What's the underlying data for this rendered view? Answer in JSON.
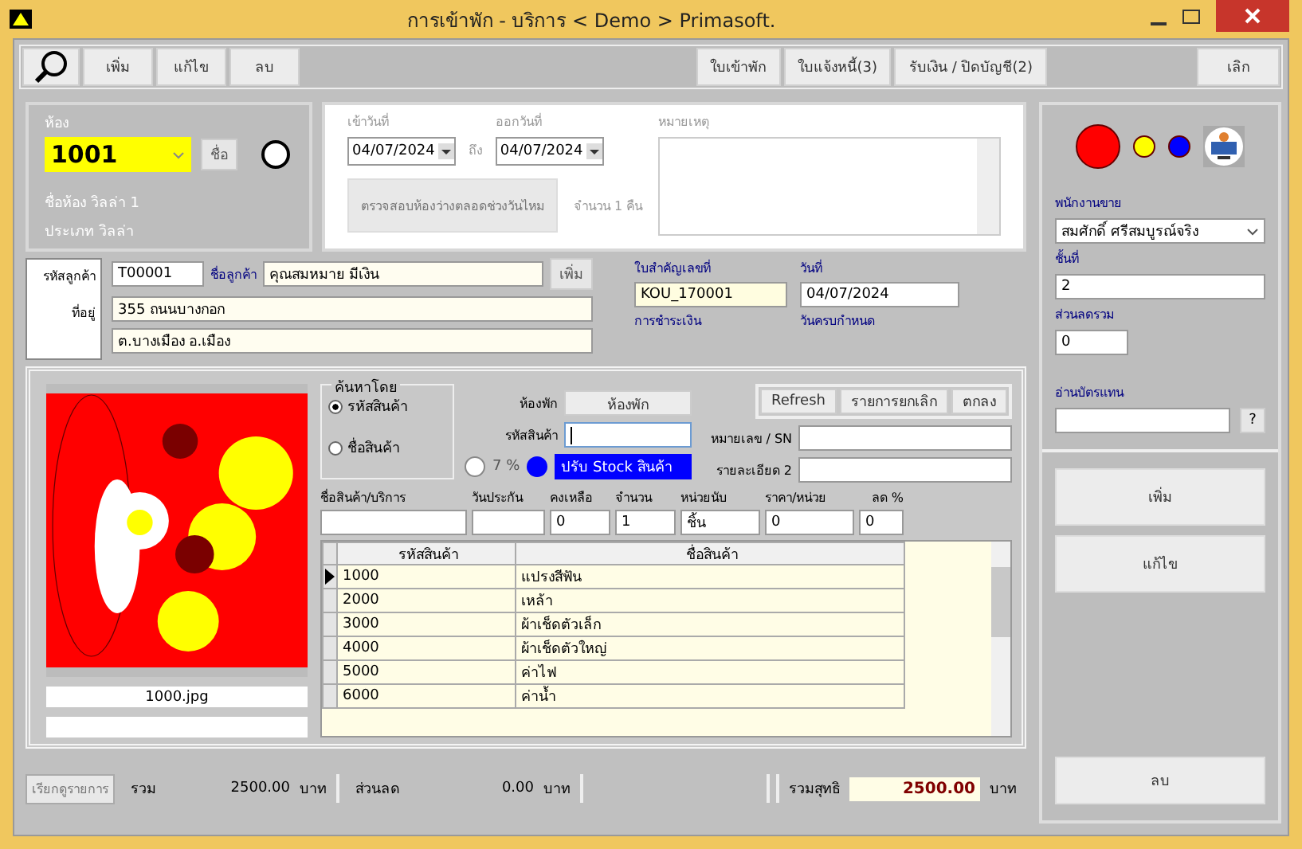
{
  "window": {
    "title": "การเข้าพัก - บริการ  < Demo > Primasoft."
  },
  "toolbar": {
    "left_buttons": [
      "เพิ่ม",
      "แก้ไข",
      "ลบ"
    ],
    "right_buttons": [
      "ใบเข้าพัก",
      "ใบแจ้งหนี้(3)",
      "รับเงิน / ปิดบัญชี(2)"
    ],
    "exit_button": "เลิก"
  },
  "room": {
    "label": "ห้อง",
    "number": "1001",
    "name_button": "ชื่อ",
    "name_line": "ชื่อห้อง วิลล่า 1",
    "type_line": "ประเภท วิลล่า"
  },
  "stay": {
    "checkin_label": "เข้าวันที่",
    "checkin": "04/07/2024",
    "to": "ถึง",
    "checkout_label": "ออกวันที่",
    "checkout": "04/07/2024",
    "check_button": "ตรวจสอบห้องว่างตลอดช่วงวันไหม",
    "nights": "จำนวน 1 คืน",
    "note_label": "หมายเหตุ"
  },
  "customer": {
    "code_label": "รหัสลูกค้า",
    "code": "T00001",
    "name_label": "ชื่อลูกค้า",
    "name": "คุณสมหมาย มีเงิน",
    "add_button": "เพิ่ม",
    "address_label": "ที่อยู่",
    "address_1": "355 ถนนบางกอก",
    "address_2": "ต.บางเมือง อ.เมือง"
  },
  "document": {
    "number_label": "ใบสำคัญเลขที่",
    "number": "KOU_170001",
    "date_label": "วันที่",
    "date": "04/07/2024",
    "payment_label": "การชำระเงิน",
    "due_label": "วันครบกำหนด"
  },
  "side": {
    "status_dots": [
      {
        "color": "#ff0000"
      },
      {
        "color": "#ffff00"
      },
      {
        "color": "#0000ff"
      }
    ],
    "salesperson_label": "พนักงานขาย",
    "salesperson": "สมศักดิ์ ศรีสมบูรณ์จริง",
    "floor_label": "ชั้นที่",
    "floor": "2",
    "discount_label": "ส่วนลดรวม",
    "discount": "0",
    "card_label": "อ่านบัตรแทน",
    "help_button": "?",
    "buttons": [
      "เพิ่ม",
      "แก้ไข"
    ],
    "delete_button": "ลบ"
  },
  "item_dialog": {
    "image_name": "1000.jpg",
    "search_by": {
      "title": "ค้นหาโดย",
      "options": [
        {
          "label": "รหัสสินค้า",
          "selected": true
        },
        {
          "label": "ชื่อสินค้า",
          "selected": false
        }
      ]
    },
    "room_label": "ห้องพัก",
    "room_button": "ห้องพัก",
    "code_label": "รหัสสินค้า",
    "vat": "7 %",
    "stock_button": "ปรับ Stock สินค้า",
    "actions": [
      "Refresh",
      "รายการยกเลิก",
      "ตกลง"
    ],
    "serial_label": "หมายเลข / SN",
    "detail_label": "รายละเอียด 2",
    "fields": [
      {
        "label": "ชื่อสินค้า/บริการ"
      },
      {
        "label": "วันประกัน"
      },
      {
        "label": "คงเหลือ",
        "value": "0"
      },
      {
        "label": "จำนวน",
        "value": "1"
      },
      {
        "label": "หน่วยนับ",
        "value": "ชิ้น"
      },
      {
        "label": "ราคา/หน่วย",
        "value": "0"
      },
      {
        "label": "ลด %",
        "value": "0"
      }
    ],
    "table": {
      "columns": [
        "รหัสสินค้า",
        "ชื่อสินค้า"
      ],
      "rows": [
        {
          "code": "1000",
          "name": "แปรงสีฟัน",
          "current": true
        },
        {
          "code": "2000",
          "name": "เหล้า",
          "current": false
        },
        {
          "code": "3000",
          "name": "ผ้าเช็ดตัวเล็ก",
          "current": false
        },
        {
          "code": "4000",
          "name": "ผ้าเช็ดตัวใหญ่",
          "current": false
        },
        {
          "code": "5000",
          "name": "ค่าไฟ",
          "current": false
        },
        {
          "code": "6000",
          "name": "ค่าน้ำ",
          "current": false
        }
      ]
    }
  },
  "status_bar": {
    "browse_button": "เรียกดูรายการ",
    "total_label": "รวม",
    "total": "2500.00",
    "total_unit": "บาท",
    "discount_label": "ส่วนลด",
    "discount": "0.00",
    "discount_unit": "บาท",
    "net_label": "รวมสุทธิ",
    "net": "2500.00",
    "net_unit": "บาท"
  }
}
